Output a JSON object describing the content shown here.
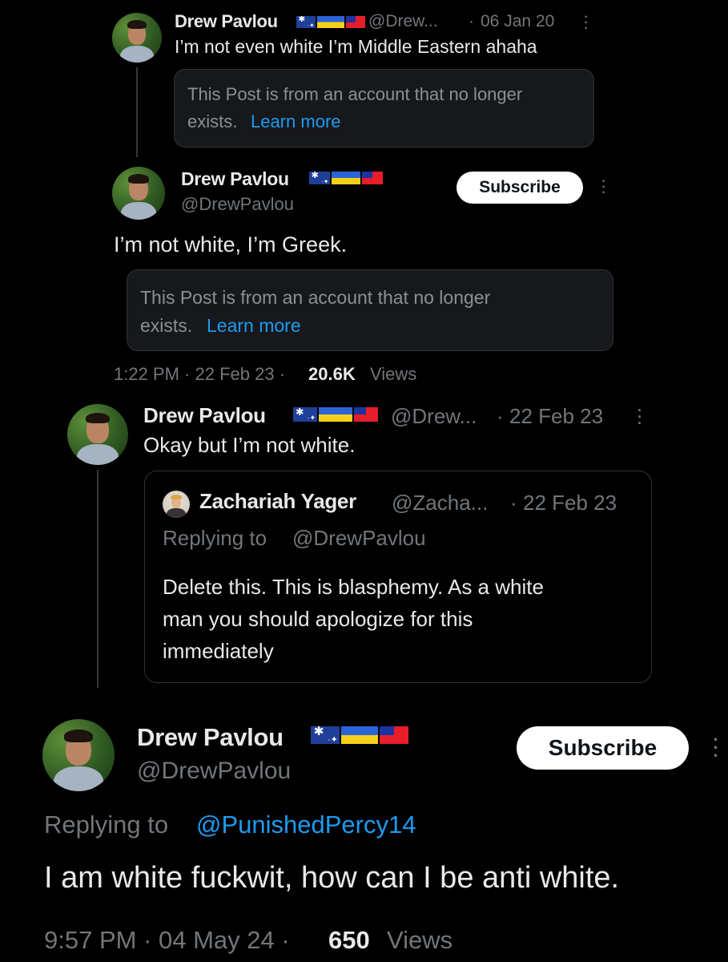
{
  "tweet1": {
    "name": "Drew Pavlou",
    "handle": "@Drew...",
    "sep": "·",
    "date": "06 Jan 20",
    "text": "I’m not even white I’m Middle Eastern ahaha",
    "notice": "This Post is from an account that no longer",
    "notice2": "exists.",
    "notice_link": "Learn more"
  },
  "tweet2": {
    "name": "Drew Pavlou",
    "handle": "@DrewPavlou",
    "subscribe": "Subscribe",
    "text": "I’m not white, I’m Greek.",
    "notice": "This Post is from an account that no longer",
    "notice2": "exists.",
    "notice_link": "Learn more",
    "meta_time": "1:22 PM · 22 Feb 23 ·",
    "views_count": "20.6K",
    "views_label": "Views"
  },
  "tweet3": {
    "name": "Drew Pavlou",
    "handle": "@Drew...",
    "sep": "·",
    "date": "22 Feb 23",
    "text": "Okay but I’m not white.",
    "quote": {
      "name": "Zachariah Yager",
      "handle": "@Zacha...",
      "sep": "·",
      "date": "22 Feb 23",
      "replying_prefix": "Replying to",
      "replying_handle": "@DrewPavlou",
      "line1": "Delete this. This is blasphemy. As a white",
      "line2": "man you should apologize for this",
      "line3": "immediately"
    }
  },
  "tweet4": {
    "name": "Drew Pavlou",
    "handle": "@DrewPavlou",
    "subscribe": "Subscribe",
    "replying_prefix": "Replying to",
    "replying_handle": "@PunishedPercy14",
    "text": "I am white fuckwit, how can I be anti white.",
    "meta_time": "9:57 PM · 04 May 24 ·",
    "views_count": "650",
    "views_label": "Views"
  },
  "icons": {
    "more": "more-vertical-icon",
    "flags": [
      "australia-flag-icon",
      "ukraine-flag-icon",
      "taiwan-flag-icon"
    ]
  },
  "colors": {
    "background": "#000000",
    "text": "#e7e9ea",
    "muted": "#71767b",
    "link": "#1d9bf0",
    "card": "#16181c",
    "border": "#2f3336"
  }
}
